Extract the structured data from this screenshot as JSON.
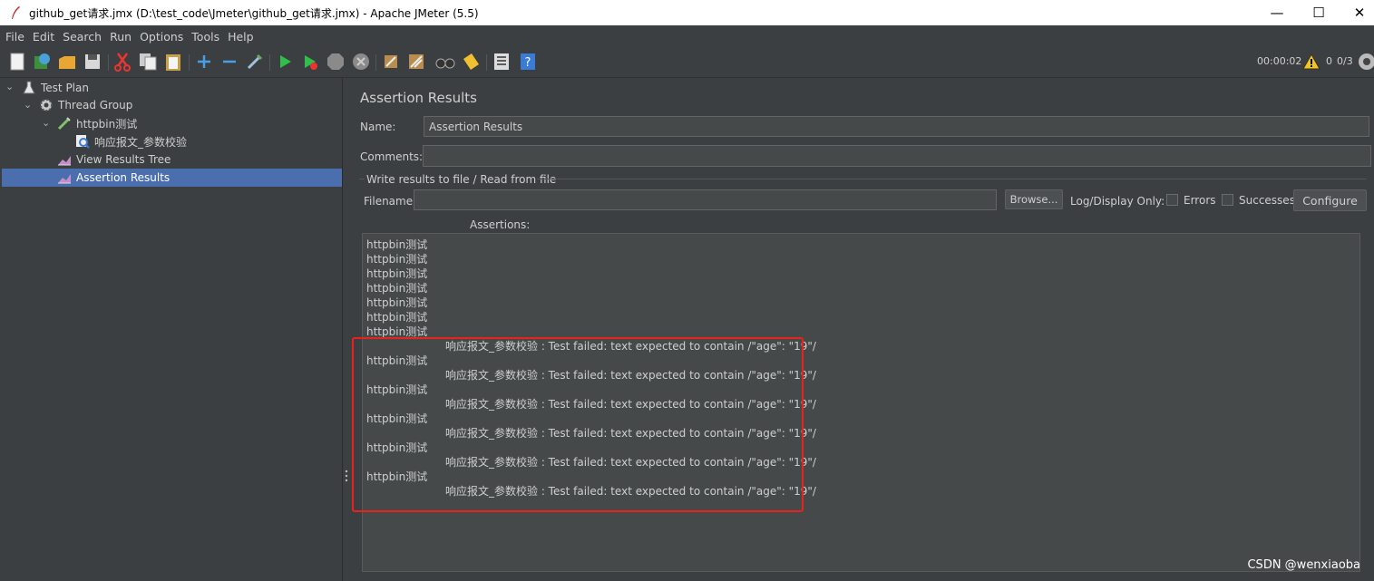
{
  "window": {
    "title": "github_get请求.jmx (D:\\test_code\\Jmeter\\github_get请求.jmx) - Apache JMeter (5.5)",
    "minimize": "—",
    "maximize": "☐",
    "close": "✕"
  },
  "menu": [
    "File",
    "Edit",
    "Search",
    "Run",
    "Options",
    "Tools",
    "Help"
  ],
  "toolbar": {
    "elapsed": "00:00:02",
    "warnings": "0",
    "threads": "0/3"
  },
  "tree": [
    {
      "label": "Test Plan",
      "icon": "test-plan-icon"
    },
    {
      "label": "Thread Group",
      "icon": "gear-icon"
    },
    {
      "label": "httpbin测试",
      "icon": "pipette-icon"
    },
    {
      "label": "响应报文_参数校验",
      "icon": "magnifier-icon"
    },
    {
      "label": "View Results Tree",
      "icon": "graph-icon"
    },
    {
      "label": "Assertion Results",
      "icon": "graph-icon"
    }
  ],
  "panel": {
    "title": "Assertion Results",
    "name_label": "Name:",
    "name_value": "Assertion Results",
    "comments_label": "Comments:",
    "comments_value": "",
    "group_title": "Write results to file / Read from file",
    "filename_label": "Filename",
    "filename_value": "",
    "browse_label": "Browse...",
    "log_display_label": "Log/Display Only:",
    "errors_label": "Errors",
    "successes_label": "Successes",
    "configure_label": "Configure",
    "assertions_label": "Assertions:"
  },
  "assertions": {
    "sampler": "httpbin测试",
    "failure": "响应报文_参数校验 : Test failed: text expected to contain /\"age\": \"19\"/"
  },
  "watermark": "CSDN @wenxiaoba",
  "colors": {
    "selection": "#4b6eaf",
    "highlight_box": "#e8231c",
    "background": "#3c3f41"
  }
}
